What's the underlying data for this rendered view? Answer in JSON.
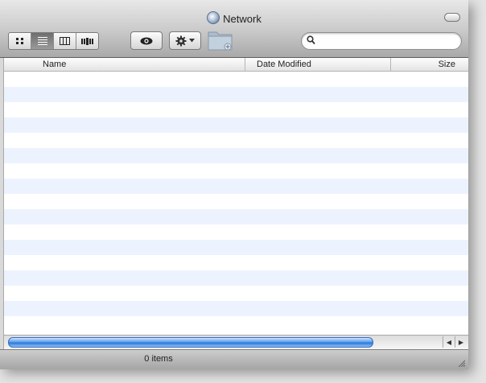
{
  "window": {
    "title": "Network",
    "title_icon": "network-globe-icon"
  },
  "toolbar": {
    "view_buttons": [
      {
        "name": "icon-view",
        "icon": "icon-view-icon",
        "glyph": "⊞",
        "active": false
      },
      {
        "name": "list-view",
        "icon": "list-view-icon",
        "glyph": "≡",
        "active": true
      },
      {
        "name": "column-view",
        "icon": "column-view-icon",
        "glyph": "▥",
        "active": false
      },
      {
        "name": "coverflow-view",
        "icon": "coverflow-view-icon",
        "glyph": "▮",
        "active": false
      }
    ],
    "quicklook_icon": "eye-icon",
    "action_icon": "gear-icon",
    "new_folder_icon": "new-folder-icon",
    "search": {
      "placeholder": "",
      "value": ""
    }
  },
  "columns": {
    "name": "Name",
    "date_modified": "Date Modified",
    "size": "Size"
  },
  "status": {
    "text": "0 items"
  },
  "colors": {
    "row_alt": "#edf3fe",
    "scroll_thumb": "#2b78d8"
  }
}
